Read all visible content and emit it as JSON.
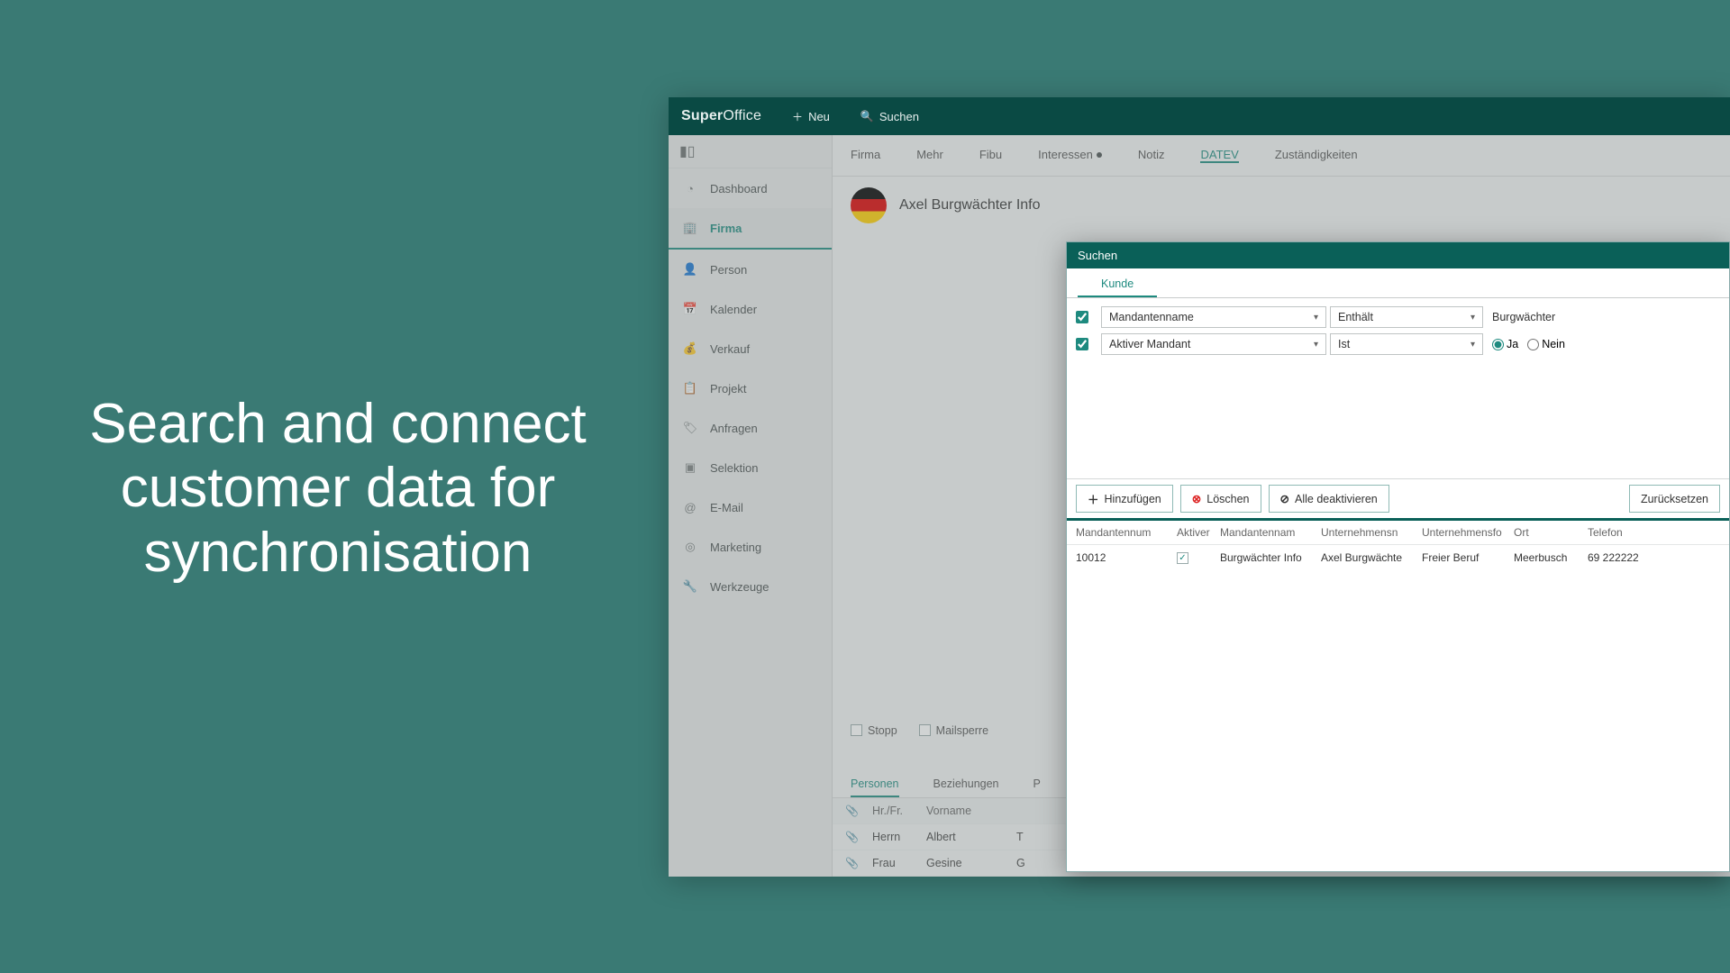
{
  "promo": "Search and connect customer data for synchronisation",
  "topbar": {
    "logo_a": "Super",
    "logo_b": "Office",
    "new": "Neu",
    "search": "Suchen"
  },
  "sidebar": {
    "items": [
      {
        "label": "Dashboard"
      },
      {
        "label": "Firma"
      },
      {
        "label": "Person"
      },
      {
        "label": "Kalender"
      },
      {
        "label": "Verkauf"
      },
      {
        "label": "Projekt"
      },
      {
        "label": "Anfragen"
      },
      {
        "label": "Selektion"
      },
      {
        "label": "E-Mail"
      },
      {
        "label": "Marketing"
      },
      {
        "label": "Werkzeuge"
      }
    ]
  },
  "firm_tabs": [
    "Firma",
    "Mehr",
    "Fibu",
    "Interessen",
    "Notiz",
    "DATEV",
    "Zuständigkeiten"
  ],
  "firm_title": "Axel Burgwächter Info",
  "firm_flags": {
    "stopp": "Stopp",
    "mailsperre": "Mailsperre"
  },
  "sub_tabs": [
    "Personen",
    "Beziehungen",
    "P"
  ],
  "ptable": {
    "head": [
      "Hr./Fr.",
      "Vorname"
    ],
    "rows": [
      {
        "hr": "Herrn",
        "vor": "Albert",
        "c": "T"
      },
      {
        "hr": "Frau",
        "vor": "Gesine",
        "c": "G"
      }
    ]
  },
  "dialog": {
    "title": "Suchen",
    "tab": "Kunde",
    "criteria": [
      {
        "field": "Mandantenname",
        "op": "Enthält",
        "val": "Burgwächter"
      },
      {
        "field": "Aktiver Mandant",
        "op": "Ist",
        "ja": "Ja",
        "nein": "Nein"
      }
    ],
    "buttons": {
      "add": "Hinzufügen",
      "del": "Löschen",
      "deact": "Alle deaktivieren",
      "reset": "Zurücksetzen"
    },
    "results": {
      "head": [
        "Mandantennum",
        "Aktiver",
        "Mandantennam",
        "Unternehmensn",
        "Unternehmensfo",
        "Ort",
        "Telefon"
      ],
      "rows": [
        {
          "num": "10012",
          "mname": "Burgwächter Info",
          "uname": "Axel Burgwächte",
          "uform": "Freier Beruf",
          "ort": "Meerbusch",
          "tel": "69 222222"
        }
      ]
    }
  }
}
